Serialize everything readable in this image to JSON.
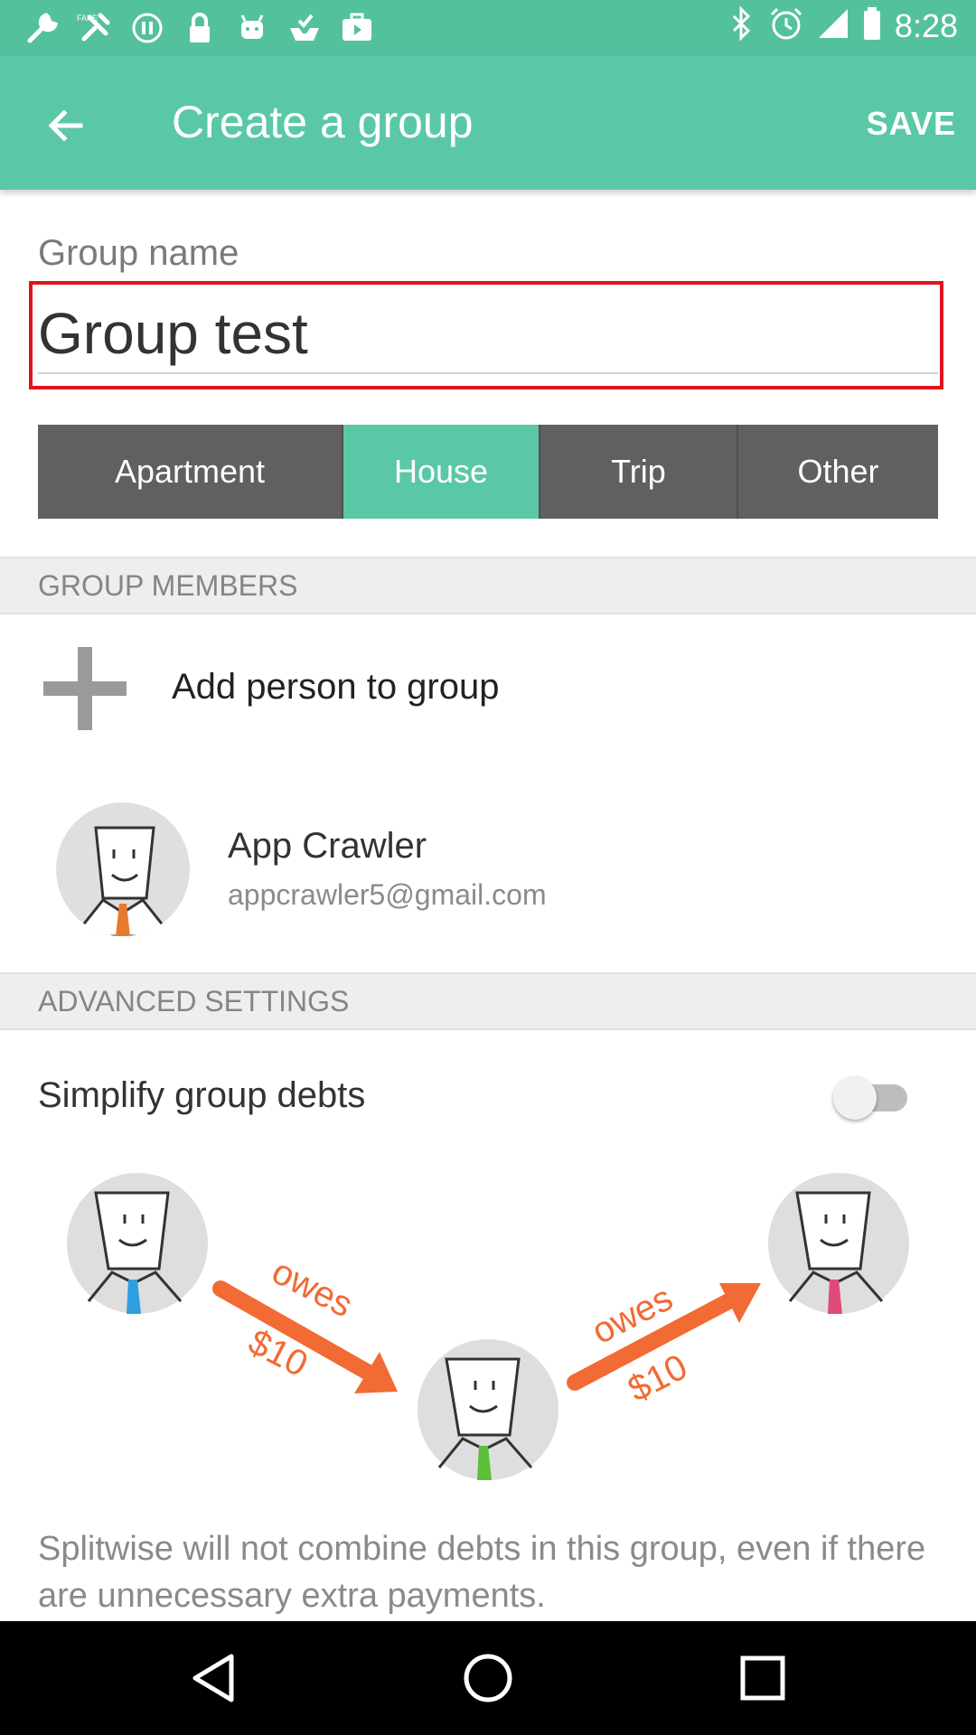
{
  "status_bar": {
    "time": "8:28",
    "left_icons": [
      "wrench-icon",
      "fake-gps-icon",
      "stop-icon",
      "lock-icon",
      "android-icon",
      "inbox-check-icon",
      "briefcase-play-icon"
    ],
    "right_icons": [
      "bluetooth-icon",
      "alarm-icon",
      "signal-icon",
      "battery-icon"
    ]
  },
  "app_bar": {
    "title": "Create a group",
    "save_label": "SAVE",
    "color": "#5ac8a6"
  },
  "group_name": {
    "label": "Group name",
    "value": "Group test"
  },
  "group_types": [
    {
      "label": "Apartment",
      "selected": false
    },
    {
      "label": "House",
      "selected": true
    },
    {
      "label": "Trip",
      "selected": false
    },
    {
      "label": "Other",
      "selected": false
    }
  ],
  "members_section": {
    "header": "GROUP MEMBERS",
    "add_label": "Add person to group",
    "members": [
      {
        "name": "App Crawler",
        "email": "appcrawler5@gmail.com"
      }
    ]
  },
  "advanced_section": {
    "header": "ADVANCED SETTINGS",
    "simplify_label": "Simplify group debts",
    "simplify_enabled": false,
    "illustration": {
      "left_label_top": "owes",
      "left_label_bottom": "$10",
      "right_label_top": "owes",
      "right_label_bottom": "$10",
      "tie_colors": [
        "#2f9fe0",
        "#5cbf3a",
        "#e04a78"
      ],
      "arrow_color": "#f26a34"
    },
    "description": "Splitwise will not combine debts in this group, even if there are unnecessary extra payments."
  },
  "nav_bar": {
    "icons": [
      "back-triangle-icon",
      "home-circle-icon",
      "recents-square-icon"
    ]
  }
}
